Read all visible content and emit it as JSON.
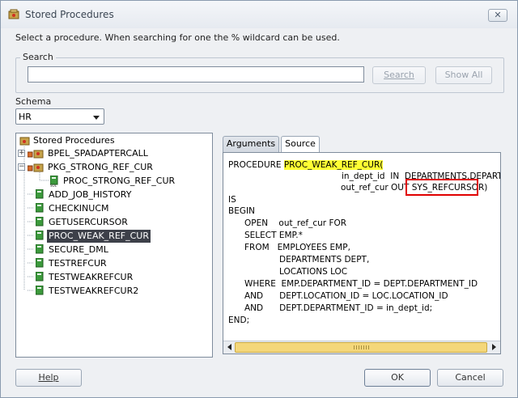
{
  "window": {
    "title": "Stored Procedures",
    "close_glyph": "✕"
  },
  "instruction": "Select a procedure. When searching for one the % wildcard can be used.",
  "search": {
    "legend": "Search",
    "value": "",
    "search_button": "Search",
    "show_all_button": "Show All"
  },
  "schema": {
    "label": "Schema",
    "selected": "HR"
  },
  "tree": {
    "root": "Stored Procedures",
    "items": [
      {
        "label": "BPEL_SPADAPTERCALL",
        "icon": "package-icon"
      },
      {
        "label": "PKG_STRONG_REF_CUR",
        "icon": "package-icon"
      },
      {
        "label": "PROC_STRONG_REF_CUR",
        "icon": "procedure-icon"
      },
      {
        "label": "ADD_JOB_HISTORY",
        "icon": "procedure-icon"
      },
      {
        "label": "CHECKINUCM",
        "icon": "procedure-icon"
      },
      {
        "label": "GETUSERCURSOR",
        "icon": "procedure-icon"
      },
      {
        "label": "PROC_WEAK_REF_CUR",
        "icon": "procedure-icon",
        "selected": true
      },
      {
        "label": "SECURE_DML",
        "icon": "procedure-icon"
      },
      {
        "label": "TESTREFCUR",
        "icon": "procedure-icon"
      },
      {
        "label": "TESTWEAKREFCUR",
        "icon": "procedure-icon"
      },
      {
        "label": "TESTWEAKREFCUR2",
        "icon": "procedure-icon"
      }
    ],
    "expander_glyph": "+",
    "collapse_glyph": "−"
  },
  "tabs": {
    "arguments": "Arguments",
    "source": "Source"
  },
  "source": {
    "line1_prefix": "PROCEDURE ",
    "line1_highlight": "PROC_WEAK_REF_CUR(",
    "line2": "in_dept_id  IN  DEPARTMENTS.DEPARTM",
    "line3_prefix": "out_ref_cur OUT ",
    "line3_boxed": "SYS_REFCURSOR)",
    "line4": "IS",
    "line5": "BEGIN",
    "line6": "OPEN    out_ref_cur FOR",
    "line7": "SELECT EMP.*",
    "line8": "FROM   EMPLOYEES EMP,",
    "line9": "DEPARTMENTS DEPT,",
    "line10": "LOCATIONS LOC",
    "line11": "WHERE  EMP.DEPARTMENT_ID = DEPT.DEPARTMENT_ID",
    "line12": "AND      DEPT.LOCATION_ID = LOC.LOCATION_ID",
    "line13": "AND      DEPT.DEPARTMENT_ID = in_dept_id;",
    "line14": "END;"
  },
  "footer": {
    "help": "Help",
    "ok": "OK",
    "cancel": "Cancel"
  },
  "colors": {
    "highlight": "#ffff33",
    "selection": "#3d4049",
    "callout": "#e00000"
  }
}
